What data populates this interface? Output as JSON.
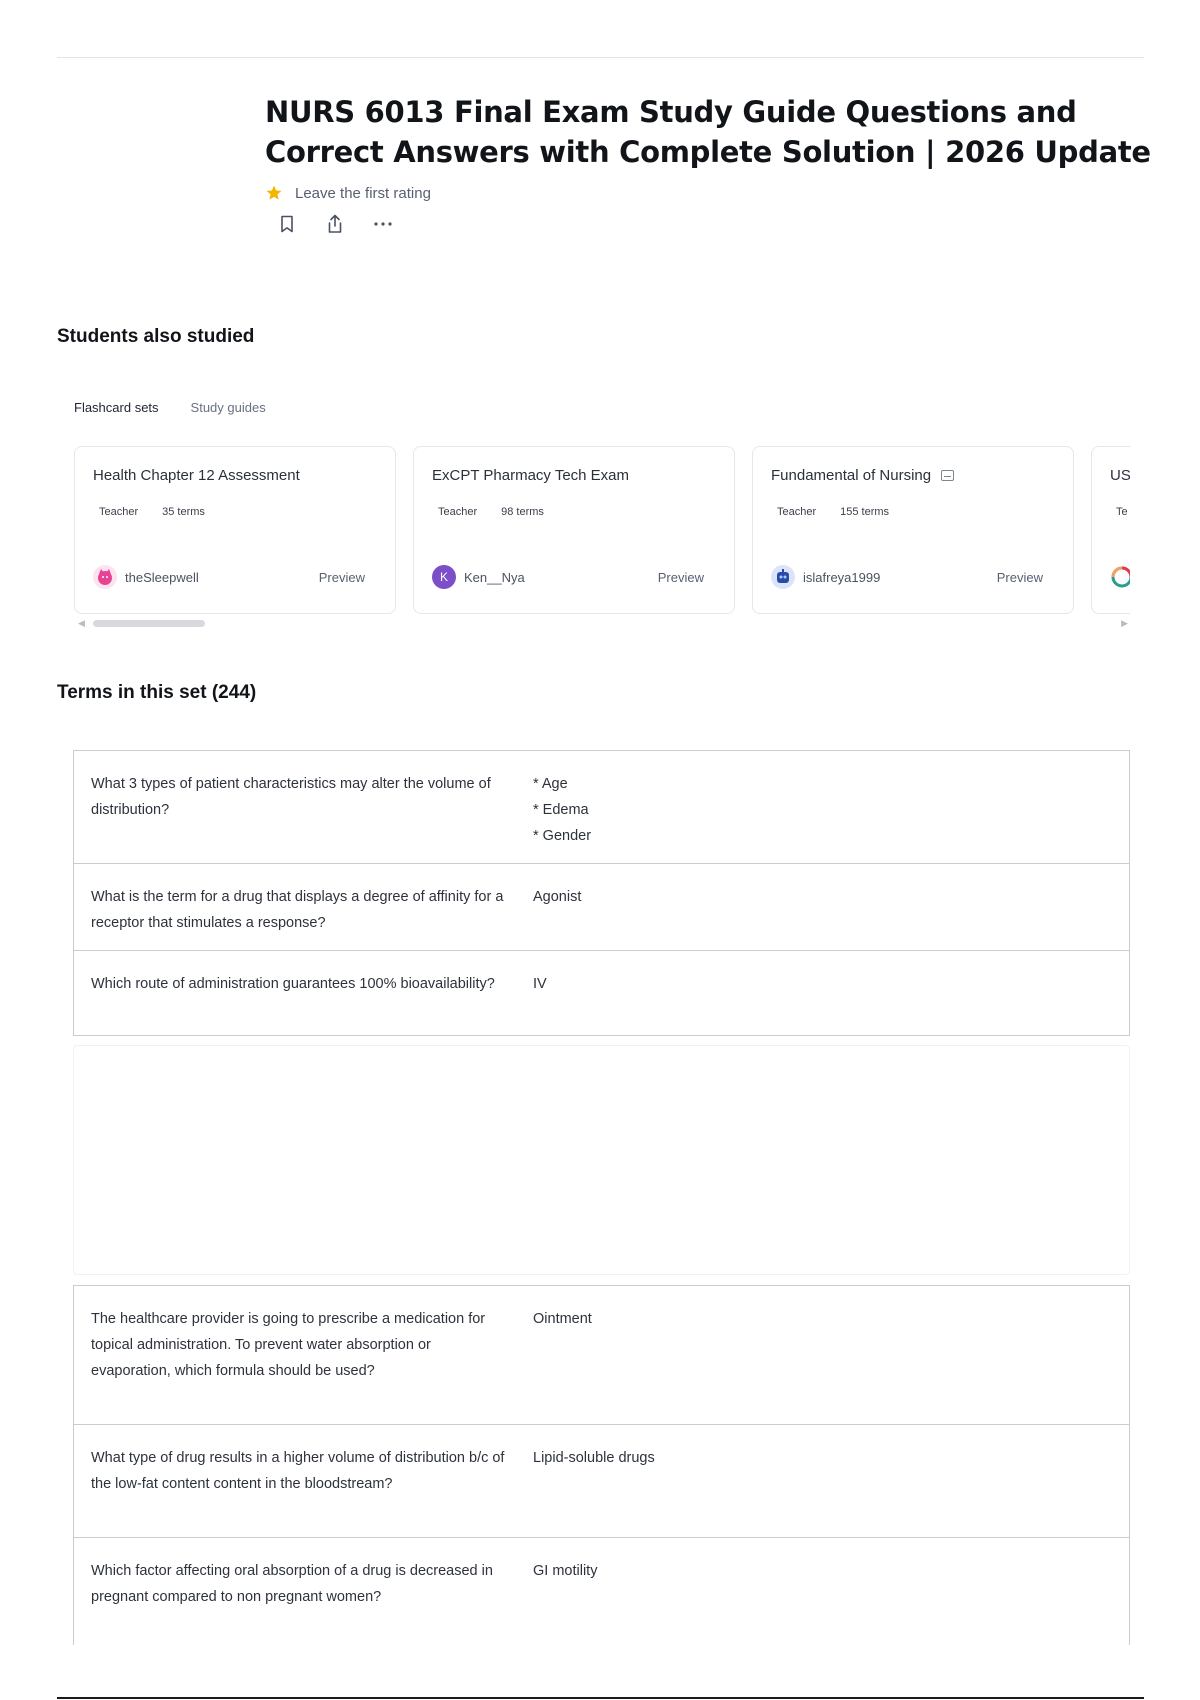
{
  "header": {
    "title": "NURS 6013 Final Exam Study Guide Questions and Correct Answers with Complete Solution | 2026 Update",
    "rating_text": "Leave the first rating",
    "actions": [
      "bookmark-icon",
      "share-icon",
      "more-icon"
    ]
  },
  "students_also_studied": {
    "title": "Students also studied",
    "tabs": [
      "Flashcard sets",
      "Study guides"
    ],
    "cards": [
      {
        "title": "Health Chapter 12 Assessment",
        "role": "Teacher",
        "terms": "35 terms",
        "author": "theSleepwell",
        "preview": "Preview",
        "avatar_icon": "cat-avatar-icon",
        "avatar_color": "#e84393"
      },
      {
        "title": "ExCPT Pharmacy Tech Exam",
        "role": "Teacher",
        "terms": "98 terms",
        "author": "Ken__Nya",
        "preview": "Preview",
        "avatar_icon": "letter-avatar-icon",
        "avatar_letter": "K",
        "avatar_color": "#7c4fc9"
      },
      {
        "title": "Fundamental of Nursing",
        "role": "Teacher",
        "terms": "155 terms",
        "author": "islafreya1999",
        "preview": "Preview",
        "avatar_icon": "robot-avatar-icon",
        "avatar_color": "#2b4aa8"
      },
      {
        "title": "US",
        "role": "Te",
        "terms": "",
        "author": "",
        "preview": "",
        "avatar_icon": "globe-avatar-icon",
        "avatar_color": "#2a9d8f"
      }
    ]
  },
  "terms": {
    "title": "Terms in this set (244)",
    "rows": [
      {
        "q": "What 3 types of patient characteristics may alter the volume of distribution?",
        "a": "* Age\n* Edema\n* Gender"
      },
      {
        "q": "What is the term for a drug that displays a degree of affinity for a receptor that stimulates a response?",
        "a": "Agonist"
      },
      {
        "q": "Which route of administration guarantees 100% bioavailability?",
        "a": "IV"
      },
      {
        "q": "The healthcare provider is going to prescribe a medication for topical administration. To prevent water absorption or evaporation, which formula should be used?",
        "a": "Ointment"
      },
      {
        "q": "What type of drug results in a higher volume of distribution b/c of the low-fat content content in the bloodstream?",
        "a": "Lipid-soluble drugs"
      },
      {
        "q": "Which factor affecting oral absorption of a drug is decreased in pregnant compared to non pregnant women?",
        "a": "GI motility"
      }
    ]
  },
  "colors": {
    "star": "#f5b400",
    "border": "#c9ccd3",
    "text": "#2d323c"
  }
}
